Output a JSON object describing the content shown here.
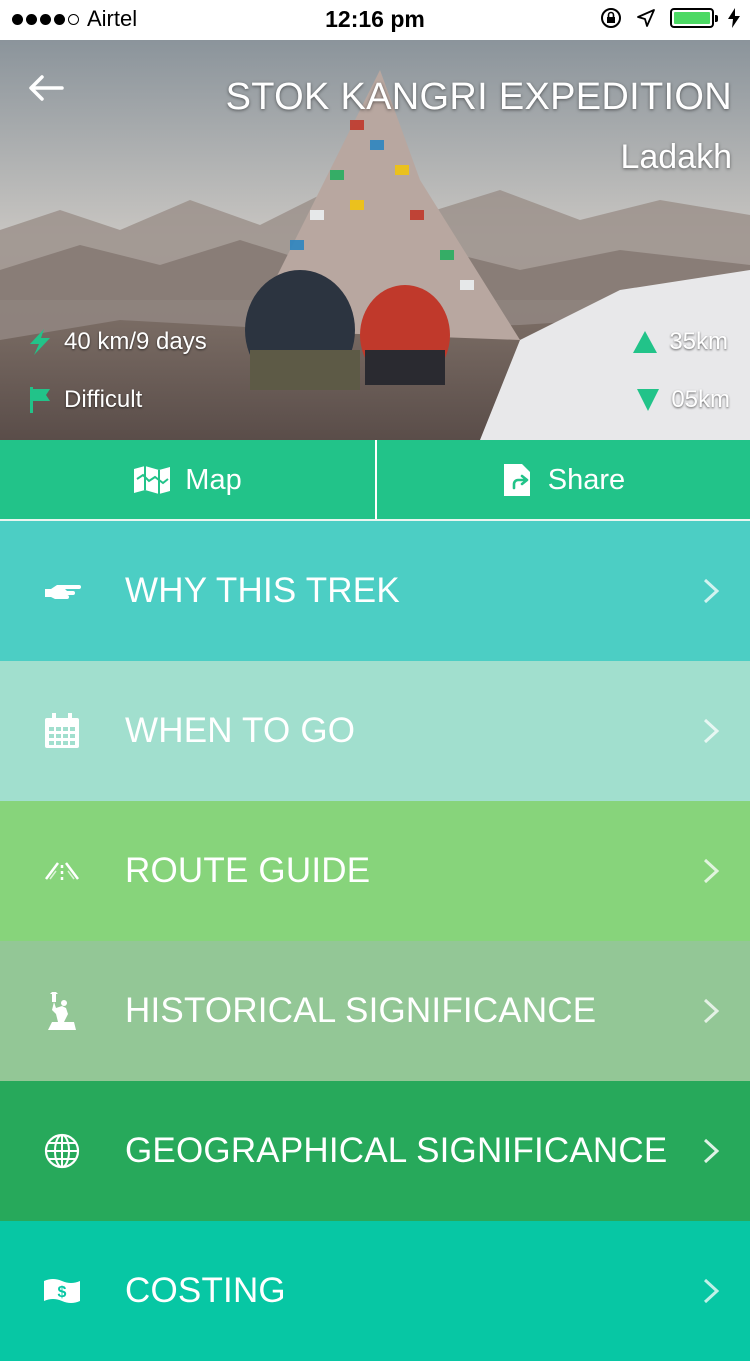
{
  "status_bar": {
    "carrier": "Airtel",
    "time": "12:16 pm"
  },
  "hero": {
    "title": "STOK KANGRI EXPEDITION",
    "region": "Ladakh",
    "distance_duration": "40 km/9 days",
    "difficulty": "Difficult",
    "ascent": "35km",
    "descent": "05km",
    "icons": {
      "back": "back-arrow-icon",
      "distance": "lightning-icon",
      "difficulty": "flag-icon",
      "ascent": "up-triangle-icon",
      "descent": "down-triangle-icon"
    }
  },
  "actions": {
    "map_label": "Map",
    "share_label": "Share"
  },
  "menu": [
    {
      "label": "WHY THIS TREK",
      "icon": "pointing-hand-icon",
      "color": "#4ccec4"
    },
    {
      "label": "WHEN TO GO",
      "icon": "calendar-icon",
      "color": "#a1dfce"
    },
    {
      "label": "ROUTE GUIDE",
      "icon": "road-icon",
      "color": "#87d47b"
    },
    {
      "label": "HISTORICAL SIGNIFICANCE",
      "icon": "statue-of-liberty-icon",
      "color": "#93c796"
    },
    {
      "label": "GEOGRAPHICAL SIGNIFICANCE",
      "icon": "globe-icon",
      "color": "#27a95b"
    },
    {
      "label": "COSTING",
      "icon": "money-icon",
      "color": "#07c7a4"
    }
  ],
  "colors": {
    "action_bar": "#22c389",
    "stat_icon": "#22c389"
  }
}
